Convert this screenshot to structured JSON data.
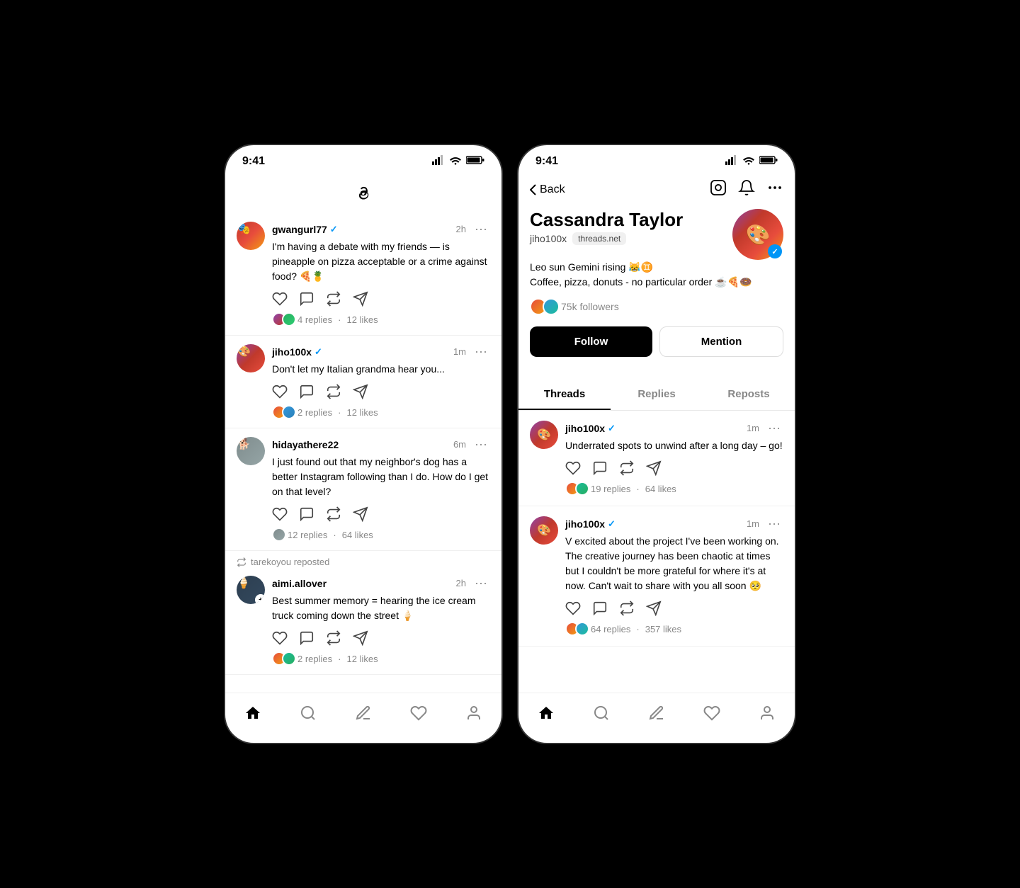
{
  "phone1": {
    "statusBar": {
      "time": "9:41",
      "signal": "▐▌▌▌",
      "wifi": "WiFi",
      "battery": "Battery"
    },
    "posts": [
      {
        "id": "post1",
        "username": "gwangurl77",
        "verified": true,
        "time": "2h",
        "text": "I'm having a debate with my friends — is pineapple on pizza acceptable or a crime against food? 🍕🍍",
        "replies": "4 replies",
        "likes": "12 likes",
        "avatarClass": "avatar-gwangurl"
      },
      {
        "id": "post2",
        "username": "jiho100x",
        "verified": true,
        "time": "1m",
        "text": "Don't let my Italian grandma hear you...",
        "replies": "2 replies",
        "likes": "12 likes",
        "avatarClass": "avatar-jiho"
      },
      {
        "id": "post3",
        "username": "hidayathere22",
        "verified": false,
        "time": "6m",
        "text": "I just found out that my neighbor's dog has a better Instagram following than I do. How do I get on that level?",
        "replies": "12 replies",
        "likes": "64 likes",
        "avatarClass": "avatar-hidaya"
      },
      {
        "id": "post4",
        "repostBy": "tarekoyou reposted",
        "username": "aimi.allover",
        "verified": false,
        "time": "2h",
        "text": "Best summer memory = hearing the ice cream truck coming down the street 🍦",
        "replies": "2 replies",
        "likes": "12 likes",
        "avatarClass": "avatar-aimi",
        "hasPlus": true
      }
    ],
    "nav": {
      "home": "Home",
      "search": "Search",
      "compose": "Compose",
      "heart": "Activity",
      "profile": "Profile"
    }
  },
  "phone2": {
    "statusBar": {
      "time": "9:41"
    },
    "header": {
      "back": "Back",
      "icons": [
        "instagram",
        "bell",
        "more"
      ]
    },
    "profile": {
      "name": "Cassandra Taylor",
      "handle": "jiho100x",
      "domain": "threads.net",
      "bio1": "Leo sun Gemini rising 😹♊",
      "bio2": "Coffee, pizza, donuts - no particular order ☕🍕🍩",
      "followers": "75k followers",
      "followBtn": "Follow",
      "mentionBtn": "Mention"
    },
    "tabs": [
      "Threads",
      "Replies",
      "Reposts"
    ],
    "activeTab": "Threads",
    "posts": [
      {
        "id": "ppost1",
        "username": "jiho100x",
        "verified": true,
        "time": "1m",
        "text": "Underrated spots to unwind after a long day – go!",
        "replies": "19 replies",
        "likes": "64 likes"
      },
      {
        "id": "ppost2",
        "username": "jiho100x",
        "verified": true,
        "time": "1m",
        "text": "V excited about the project I've been working on. The creative journey has been chaotic at times but I couldn't be more grateful for where it's at now. Can't wait to share with you all soon 🥺",
        "replies": "64 replies",
        "likes": "357 likes"
      }
    ]
  }
}
